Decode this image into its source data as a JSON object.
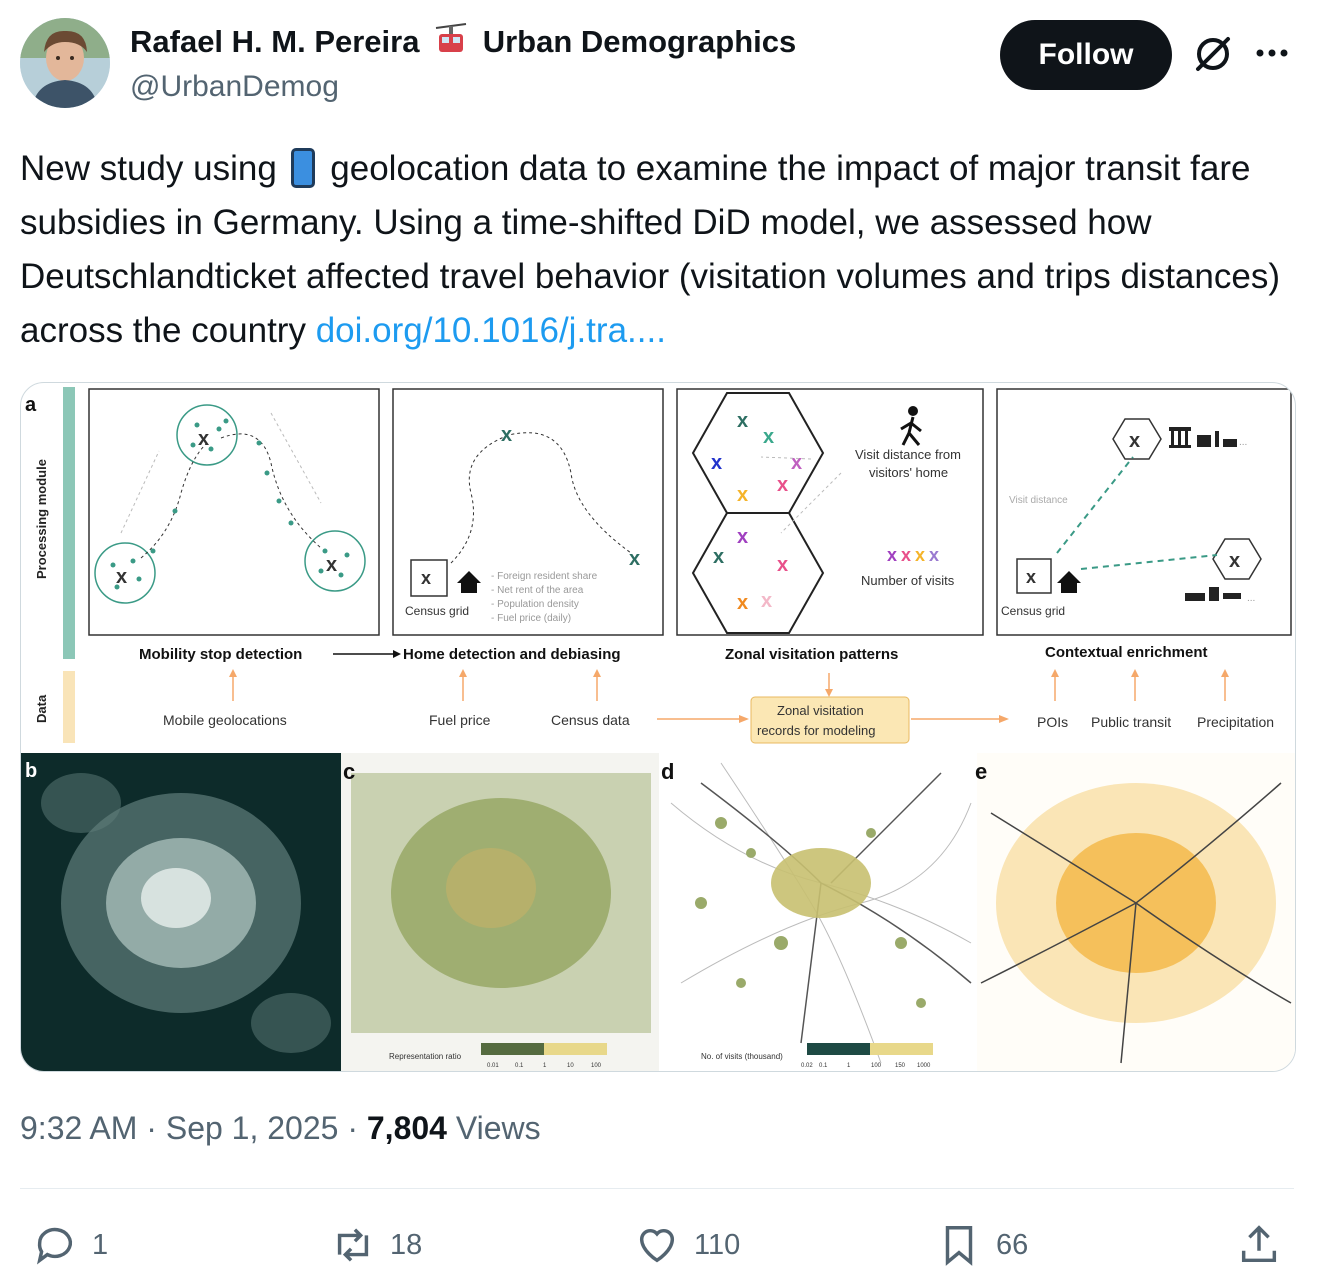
{
  "author": {
    "display_name_part1": "Rafael H. M. Pereira",
    "display_name_part2": "Urban Demographics",
    "handle": "@UrbanDemog"
  },
  "header": {
    "follow_label": "Follow",
    "grok_icon": "grok-icon",
    "more_icon": "more-icon"
  },
  "tweet": {
    "text_part1": "New study using",
    "text_part2": "geolocation data to examine the impact of major transit fare subsidies in Germany. Using a time-shifted DiD model, we assessed how Deutschlandticket affected travel behavior (visitation volumes and trips distances) across the country",
    "link": "doi.org/10.1016/j.tra...."
  },
  "figure": {
    "panel_a_label": "a",
    "panel_b_label": "b",
    "panel_c_label": "c",
    "panel_d_label": "d",
    "panel_e_label": "e",
    "row_processing": "Processing module",
    "row_data": "Data",
    "step1": "Mobility stop detection",
    "step2": "Home detection and debiasing",
    "step3": "Zonal visitation patterns",
    "step4": "Contextual enrichment",
    "home_features": [
      "- Foreign resident share",
      "- Net rent of the area",
      "- Population density",
      "- Fuel price (daily)"
    ],
    "census_grid": "Census grid",
    "census_grid_2": "Census grid",
    "visit_distance_1": "Visit distance from",
    "visit_distance_2": "visitors' home",
    "number_of_visits": "Number of visits",
    "visit_distance_label": "Visit distance",
    "data_mobile": "Mobile geolocations",
    "data_fuel": "Fuel price",
    "data_census": "Census data",
    "zonal_records_1": "Zonal visitation",
    "zonal_records_2": "records for modeling",
    "data_pois": "POIs",
    "data_transit": "Public transit",
    "data_precip": "Precipitation",
    "legend_c_title": "Representation ratio",
    "legend_c_ticks": [
      "0.01",
      "0.1",
      "1",
      "10",
      "100"
    ],
    "legend_d_title": "No. of visits (thousand)",
    "legend_d_ticks": [
      "0.02",
      "0.1",
      "1",
      "100",
      "150",
      "1000"
    ],
    "colors": {
      "teal": "#3a9a86",
      "orange": "#f5a623",
      "dark_map": "#0d2b2a",
      "olive": "#9aaa6a",
      "gold": "#f2b134"
    }
  },
  "meta": {
    "time": "9:32 AM",
    "sep": "·",
    "date": "Sep 1, 2025",
    "views_count": "7,804",
    "views_label": "Views"
  },
  "actions": {
    "replies": "1",
    "reposts": "18",
    "likes": "110",
    "bookmarks": "66"
  }
}
